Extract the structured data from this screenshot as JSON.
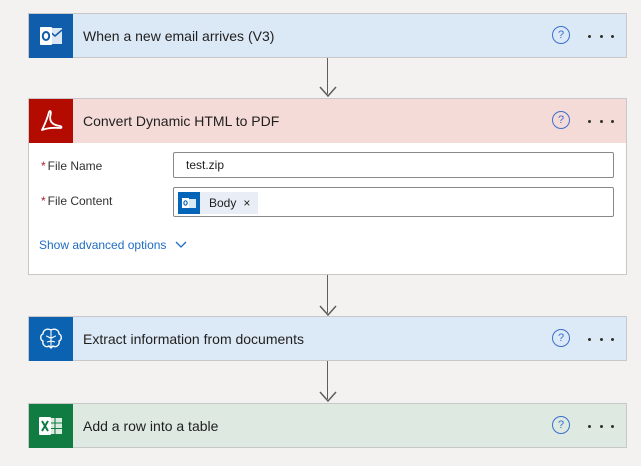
{
  "colors": {
    "outlook_header": "#dbe9f7",
    "outlook_icon": "#0f5dab",
    "pdf_header": "#f4dbd7",
    "pdf_icon": "#b30b00",
    "ai_header": "#dce9f6",
    "ai_icon": "#0a62b0",
    "excel_header": "#dde9e1",
    "excel_icon": "#107c41",
    "link": "#1f6cc2"
  },
  "steps": [
    {
      "title": "When a new email arrives (V3)",
      "icon": "outlook-icon",
      "help": "?"
    },
    {
      "title": "Convert Dynamic HTML to PDF",
      "icon": "acrobat-pdf-icon",
      "help": "?",
      "fields": [
        {
          "label": "File Name",
          "required": "*",
          "value": "test.zip"
        },
        {
          "label": "File Content",
          "required": "*",
          "token": {
            "label": "Body",
            "icon": "outlook-icon",
            "remove": "×"
          }
        }
      ],
      "advanced_label": "Show advanced options"
    },
    {
      "title": "Extract information from documents",
      "icon": "ai-brain-icon",
      "help": "?"
    },
    {
      "title": "Add a row into a table",
      "icon": "excel-icon",
      "help": "?"
    }
  ]
}
